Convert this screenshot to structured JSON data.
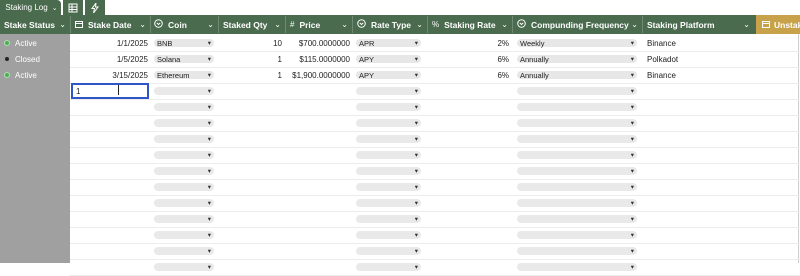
{
  "tabs": {
    "active_label": "Staking Log",
    "active_chevron": "⌄",
    "icon_table": "table-icon",
    "icon_automation": "lightning-icon"
  },
  "columns": [
    {
      "label": "Stake Status",
      "icon": "",
      "dropdown": "⌄"
    },
    {
      "label": "Stake Date",
      "icon": "calendar-icon",
      "dropdown": "⌄"
    },
    {
      "label": "Coin",
      "icon": "dropdown-field-icon",
      "dropdown": "⌄"
    },
    {
      "label": "Staked Qty",
      "icon": "",
      "dropdown": "⌄"
    },
    {
      "label": "Price",
      "icon": "hash-icon",
      "dropdown": "⌄"
    },
    {
      "label": "Rate Type",
      "icon": "dropdown-field-icon",
      "dropdown": "⌄"
    },
    {
      "label": "Staking Rate",
      "icon": "percent-icon",
      "dropdown": "⌄"
    },
    {
      "label": "Compunding Frequency",
      "icon": "dropdown-field-icon",
      "dropdown": "⌄"
    },
    {
      "label": "Staking Platform",
      "icon": "",
      "dropdown": "⌄"
    },
    {
      "label": "Unstak",
      "icon": "calendar-icon",
      "dropdown": ""
    }
  ],
  "rows": [
    {
      "status": "Active",
      "status_color": "#4caf50",
      "date": "1/1/2025",
      "coin": "BNB",
      "qty": "10",
      "price": "$700.0000000",
      "rate_type": "APR",
      "rate": "2%",
      "frequency": "Weekly",
      "platform": "Binance"
    },
    {
      "status": "Closed",
      "status_color": "#222222",
      "date": "1/5/2025",
      "coin": "Solana",
      "qty": "1",
      "price": "$115.0000000",
      "rate_type": "APY",
      "rate": "6%",
      "frequency": "Annually",
      "platform": "Polkadot"
    },
    {
      "status": "Active",
      "status_color": "#4caf50",
      "date": "3/15/2025",
      "coin": "Ethereum",
      "qty": "1",
      "price": "$1,900.0000000",
      "rate_type": "APY",
      "rate": "6%",
      "frequency": "Annually",
      "platform": "Binance"
    }
  ],
  "editor": {
    "value": "1"
  },
  "empty_row_count": 11,
  "colors": {
    "header": "#4a6b4e",
    "left_column": "#a0a0a0",
    "unstake_header": "#c8a24a",
    "editor_border": "#2f56c4"
  }
}
